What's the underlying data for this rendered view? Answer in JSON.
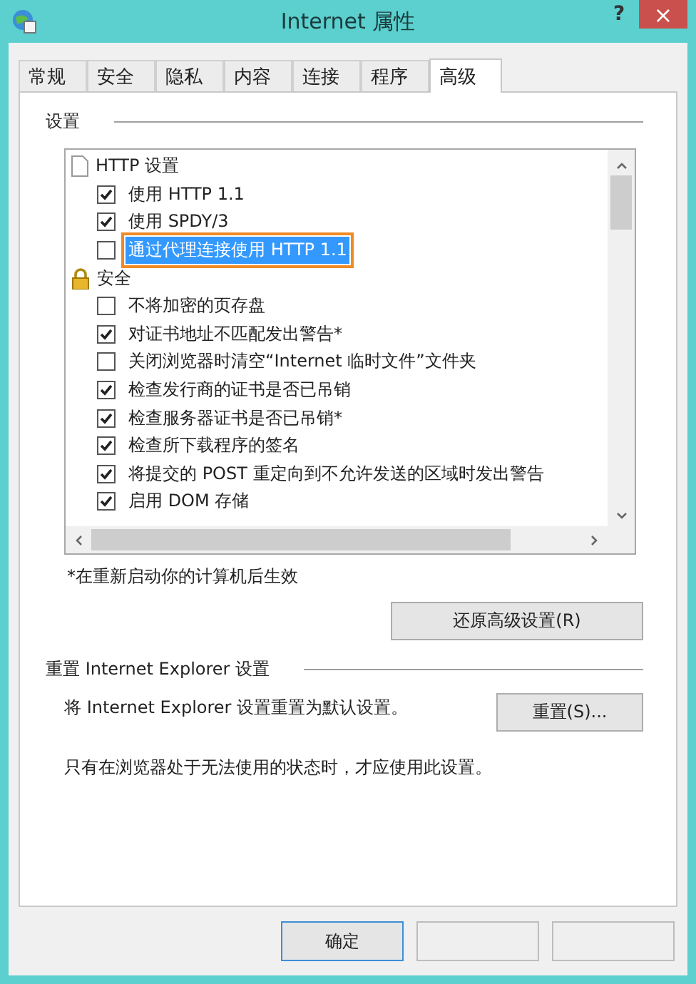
{
  "window": {
    "title": "Internet 属性",
    "help": "?",
    "close": "×"
  },
  "tabs": [
    {
      "label": "常规",
      "selected": false
    },
    {
      "label": "安全",
      "selected": false
    },
    {
      "label": "隐私",
      "selected": false
    },
    {
      "label": "内容",
      "selected": false
    },
    {
      "label": "连接",
      "selected": false
    },
    {
      "label": "程序",
      "selected": false
    },
    {
      "label": "高级",
      "selected": true
    }
  ],
  "settings": {
    "title": "设置",
    "groups": [
      {
        "label": "HTTP 设置",
        "kind": "document",
        "children": [
          {
            "label": "使用 HTTP 1.1",
            "checked": true,
            "selected": false
          },
          {
            "label": "使用 SPDY/3",
            "checked": true,
            "selected": false
          },
          {
            "label": "通过代理连接使用 HTTP 1.1",
            "checked": false,
            "selected": true
          }
        ]
      },
      {
        "label": "安全",
        "kind": "lock",
        "children": [
          {
            "label": "不将加密的页存盘",
            "checked": false,
            "selected": false
          },
          {
            "label": "对证书地址不匹配发出警告*",
            "checked": true,
            "selected": false
          },
          {
            "label": "关闭浏览器时清空“Internet 临时文件”文件夹",
            "checked": false,
            "selected": false
          },
          {
            "label": "检查发行商的证书是否已吊销",
            "checked": true,
            "selected": false
          },
          {
            "label": "检查服务器证书是否已吊销*",
            "checked": true,
            "selected": false
          },
          {
            "label": "检查所下载程序的签名",
            "checked": true,
            "selected": false
          },
          {
            "label": "将提交的 POST 重定向到不允许发送的区域时发出警告",
            "checked": true,
            "selected": false
          },
          {
            "label": "启用 DOM 存储",
            "checked": true,
            "selected": false
          }
        ]
      }
    ],
    "note": "*在重新启动你的计算机后生效",
    "restore_button": "还原高级设置(R)"
  },
  "reset": {
    "title": "重置 Internet Explorer 设置",
    "description": "将 Internet Explorer 设置重置为默认设置。",
    "button": "重置(S)...",
    "note": "只有在浏览器处于无法使用的状态时，才应使用此设置。"
  },
  "buttons": [
    {
      "label": "确定",
      "disabled": false
    },
    {
      "disabled": true
    },
    {
      "disabled": true
    }
  ]
}
